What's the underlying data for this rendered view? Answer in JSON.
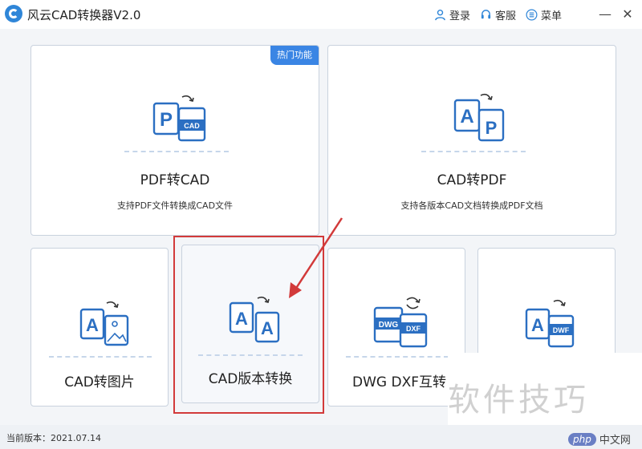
{
  "app": {
    "title": "风云CAD转换器V2.0"
  },
  "titlebar": {
    "login": "登录",
    "service": "客服",
    "menu": "菜单",
    "minimize_glyph": "—",
    "close_glyph": "✕"
  },
  "cards": {
    "pdf_to_cad": {
      "title": "PDF转CAD",
      "desc": "支持PDF文件转换成CAD文件",
      "badge": "热门功能",
      "icon_big": "P",
      "icon_small": "CAD"
    },
    "cad_to_pdf": {
      "title": "CAD转PDF",
      "desc": "支持各版本CAD文档转换成PDF文档",
      "icon_big": "A",
      "icon_small": "P"
    },
    "cad_to_image": {
      "title": "CAD转图片",
      "icon_big": "A"
    },
    "cad_version": {
      "title": "CAD版本转换",
      "icon_big": "A",
      "icon_small": "A"
    },
    "dwg_dxf": {
      "title": "DWG DXF互转",
      "icon_big": "DWG",
      "icon_small": "DXF"
    },
    "cad_to_dwf": {
      "icon_big": "A",
      "icon_small": "DWF"
    }
  },
  "status": {
    "version_label": "当前版本：2021.07.14"
  },
  "watermark": {
    "text": "软件技巧",
    "site": "php",
    "site_cn": "中文网"
  },
  "colors": {
    "accent": "#3a85e4",
    "highlight": "#d23a3a",
    "icon_blue": "#2b6fc2"
  }
}
